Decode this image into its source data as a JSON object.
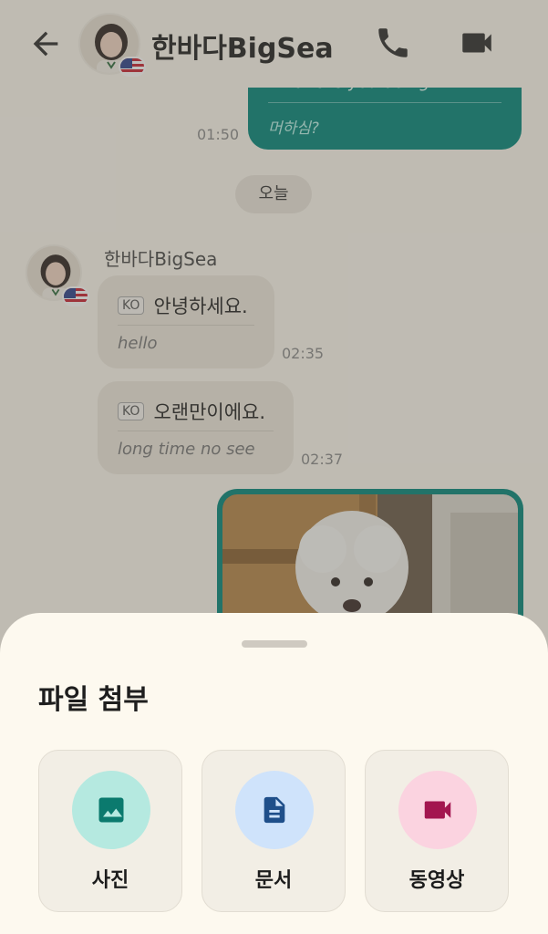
{
  "header": {
    "contact_name": "한바다BigSea",
    "icons": {
      "back": "arrow-left-icon",
      "call": "phone-icon",
      "video": "video-camera-icon"
    }
  },
  "messages": {
    "outgoing_partial": {
      "text": "What are you doing?",
      "translation": "머하심?",
      "time": "01:50"
    },
    "date_divider": "오늘",
    "sender_name": "한바다BigSea",
    "incoming": [
      {
        "lang": "KO",
        "text": "안녕하세요.",
        "translation": "hello",
        "time": "02:35"
      },
      {
        "lang": "KO",
        "text": "오랜만이에요.",
        "translation": "long time no see",
        "time": "02:37"
      }
    ]
  },
  "sheet": {
    "title": "파일 첨부",
    "options": [
      {
        "label": "사진",
        "icon": "image-icon",
        "color": "#0b7a6e",
        "bg": "#b5e9e0"
      },
      {
        "label": "문서",
        "icon": "document-icon",
        "color": "#1f4f8a",
        "bg": "#cfe3fb"
      },
      {
        "label": "동영상",
        "icon": "video-camera-icon",
        "color": "#a3154f",
        "bg": "#fbd3e0"
      }
    ]
  },
  "colors": {
    "accent": "#00857a",
    "overlay": "#5a5650",
    "background": "#fdf9ef"
  }
}
